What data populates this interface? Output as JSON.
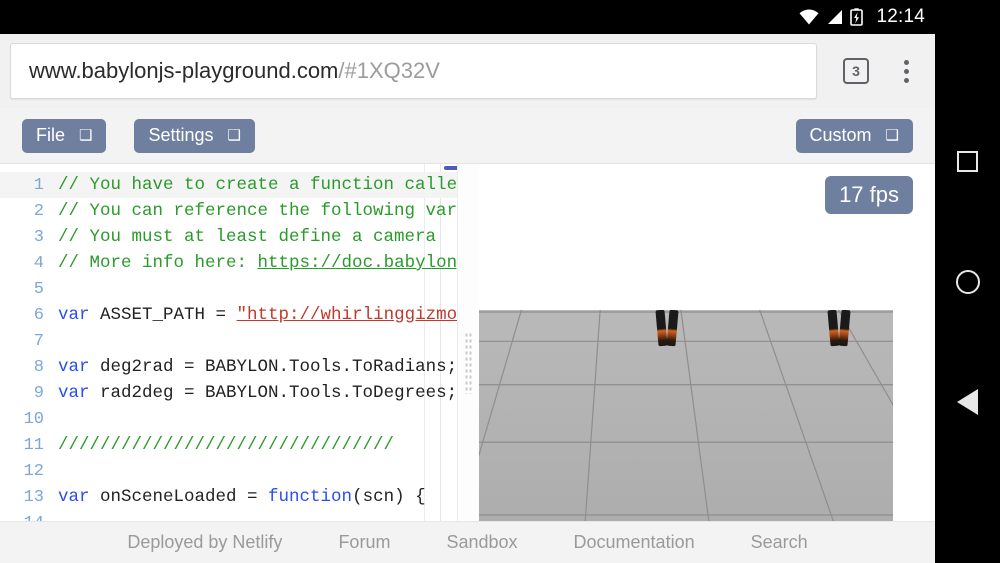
{
  "statusbar": {
    "time": "12:14",
    "icons": [
      "wifi-icon",
      "cellular-signal-icon",
      "battery-charging-icon"
    ]
  },
  "browser": {
    "url_domain": "www.babylonjs-playground.com",
    "url_path": "/#1XQ32V",
    "tab_count": "3",
    "menu_icon": "kebab-menu-icon"
  },
  "toolbar": {
    "file_label": "File",
    "settings_label": "Settings",
    "custom_label": "Custom",
    "chevron": "⌄",
    "button_color": "#6f7f9f"
  },
  "editor": {
    "lines": [
      {
        "n": "1",
        "tokens": [
          {
            "t": "cmt",
            "v": "// You have to create a function called c"
          }
        ]
      },
      {
        "n": "2",
        "tokens": [
          {
            "t": "cmt",
            "v": "// You can reference the following variab"
          }
        ]
      },
      {
        "n": "3",
        "tokens": [
          {
            "t": "cmt",
            "v": "// You must at least define a camera"
          }
        ]
      },
      {
        "n": "4",
        "tokens": [
          {
            "t": "cmt",
            "v": "// More info here: "
          },
          {
            "t": "lnk",
            "v": "https://doc.babylonjs."
          }
        ]
      },
      {
        "n": "5",
        "tokens": []
      },
      {
        "n": "6",
        "tokens": [
          {
            "t": "kw",
            "v": "var"
          },
          {
            "t": "plain",
            "v": " ASSET_PATH = "
          },
          {
            "t": "str",
            "v": "\"http://whirlinggizmo.cc"
          }
        ]
      },
      {
        "n": "7",
        "tokens": []
      },
      {
        "n": "8",
        "tokens": [
          {
            "t": "kw",
            "v": "var"
          },
          {
            "t": "plain",
            "v": " deg2rad = BABYLON.Tools.ToRadians;"
          }
        ]
      },
      {
        "n": "9",
        "tokens": [
          {
            "t": "kw",
            "v": "var"
          },
          {
            "t": "plain",
            "v": " rad2deg = BABYLON.Tools.ToDegrees;"
          }
        ]
      },
      {
        "n": "10",
        "tokens": []
      },
      {
        "n": "11",
        "tokens": [
          {
            "t": "cmt",
            "v": "////////////////////////////////"
          }
        ]
      },
      {
        "n": "12",
        "tokens": []
      },
      {
        "n": "13",
        "tokens": [
          {
            "t": "kw",
            "v": "var"
          },
          {
            "t": "plain",
            "v": " onSceneLoaded = "
          },
          {
            "t": "kw",
            "v": "function"
          },
          {
            "t": "plain",
            "v": "(scn) {"
          }
        ]
      },
      {
        "n": "14",
        "tokens": []
      }
    ]
  },
  "viewport": {
    "fps_label": "17 fps",
    "scene_description": "grid-floor-with-two-characters"
  },
  "footer": {
    "links": [
      "Deployed by Netlify",
      "Forum",
      "Sandbox",
      "Documentation",
      "Search"
    ]
  },
  "navbar": {
    "recents": "square-recents-icon",
    "home": "circle-home-icon",
    "back": "triangle-back-icon"
  }
}
